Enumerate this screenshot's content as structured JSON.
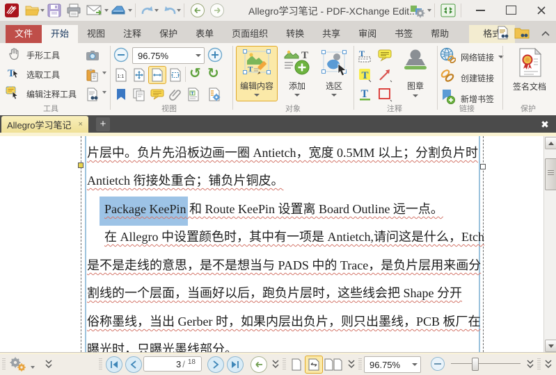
{
  "titlebar": {
    "title": "Allegro学习笔记 - PDF-XChange Edit.."
  },
  "ribbon": {
    "tabs": [
      {
        "label": "文件"
      },
      {
        "label": "开始"
      },
      {
        "label": "视图"
      },
      {
        "label": "注释"
      },
      {
        "label": "保护"
      },
      {
        "label": "表单"
      },
      {
        "label": "页面组织"
      },
      {
        "label": "转换"
      },
      {
        "label": "共享"
      },
      {
        "label": "审阅"
      },
      {
        "label": "书签"
      },
      {
        "label": "帮助"
      },
      {
        "label": "格式"
      }
    ],
    "tools": {
      "label": "工具",
      "hand": "手形工具",
      "select": "选取工具",
      "edit_comment": "编辑注释工具"
    },
    "view": {
      "label": "视图",
      "zoom": "96.75%",
      "ratio": "1:1"
    },
    "object": {
      "label": "对象",
      "edit": "编辑内容",
      "add": "添加",
      "selection": "选区"
    },
    "comment": {
      "label": "注释",
      "stamp": "图章"
    },
    "links": {
      "label": "链接",
      "web": "网络链接",
      "create": "创建链接",
      "bookmark": "新增书签"
    },
    "protect": {
      "label": "保护",
      "sign": "签名文档"
    }
  },
  "doctabs": {
    "active": "Allegro学习笔记",
    "close": "×",
    "add": "+",
    "close_all": "✖"
  },
  "document": {
    "line1": "片层中。负片先沿板边画一圈 Antietch，宽度 0.5MM 以上；分割负片时",
    "line2": "Antietch 衔接处重合；铺负片铜皮。",
    "line3_selected": "Package KeePin",
    "line3_rest": " 和 Route KeePin 设置离 Board Outline 远一点。",
    "line4": "在 Allegro 中设置颜色时，其中有一项是 Antietch,请问这是什么，Etch",
    "line5": "是不是走线的意思，是不是想当与 PADS 中的 Trace，是负片层用来画分",
    "line6": "割线的一个层面，当画好以后，跑负片层时，这些线会把 Shape 分开",
    "line7": "俗称墨线，当出 Gerber 时，如果内层出负片，则只出墨线，PCB 板厂在",
    "line8": "曝光时，只曝光墨线部分。"
  },
  "statusbar": {
    "page": "3",
    "page_sep": "/",
    "total": "18",
    "zoom": "96.75%"
  }
}
